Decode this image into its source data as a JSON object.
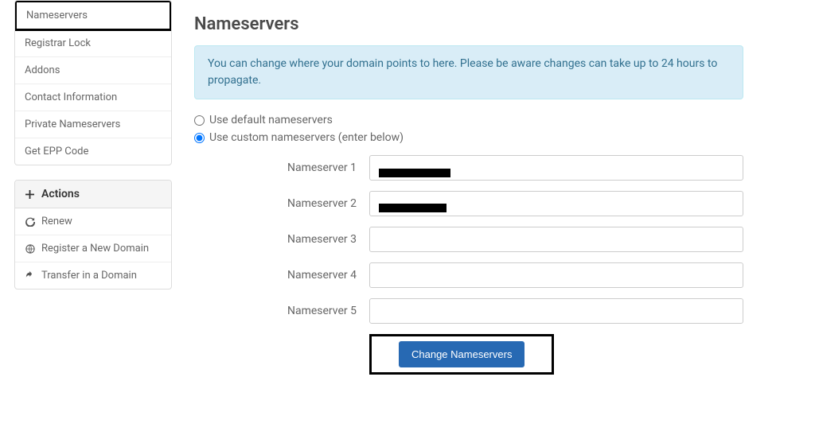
{
  "sidebar": {
    "manage_items": [
      {
        "label": "Nameservers",
        "highlighted": true
      },
      {
        "label": "Registrar Lock"
      },
      {
        "label": "Addons"
      },
      {
        "label": "Contact Information"
      },
      {
        "label": "Private Nameservers"
      },
      {
        "label": "Get EPP Code"
      }
    ],
    "actions_heading": "Actions",
    "actions_items": [
      {
        "label": "Renew",
        "icon": "refresh-icon"
      },
      {
        "label": "Register a New Domain",
        "icon": "globe-icon"
      },
      {
        "label": "Transfer in a Domain",
        "icon": "share-icon"
      }
    ]
  },
  "main": {
    "title": "Nameservers",
    "alert": "You can change where your domain points to here. Please be aware changes can take up to 24 hours to propagate.",
    "radio_default": "Use default nameservers",
    "radio_custom": "Use custom nameservers (enter below)",
    "ns_labels": [
      "Nameserver 1",
      "Nameserver 2",
      "Nameserver 3",
      "Nameserver 4",
      "Nameserver 5"
    ],
    "submit_label": "Change Nameservers"
  }
}
